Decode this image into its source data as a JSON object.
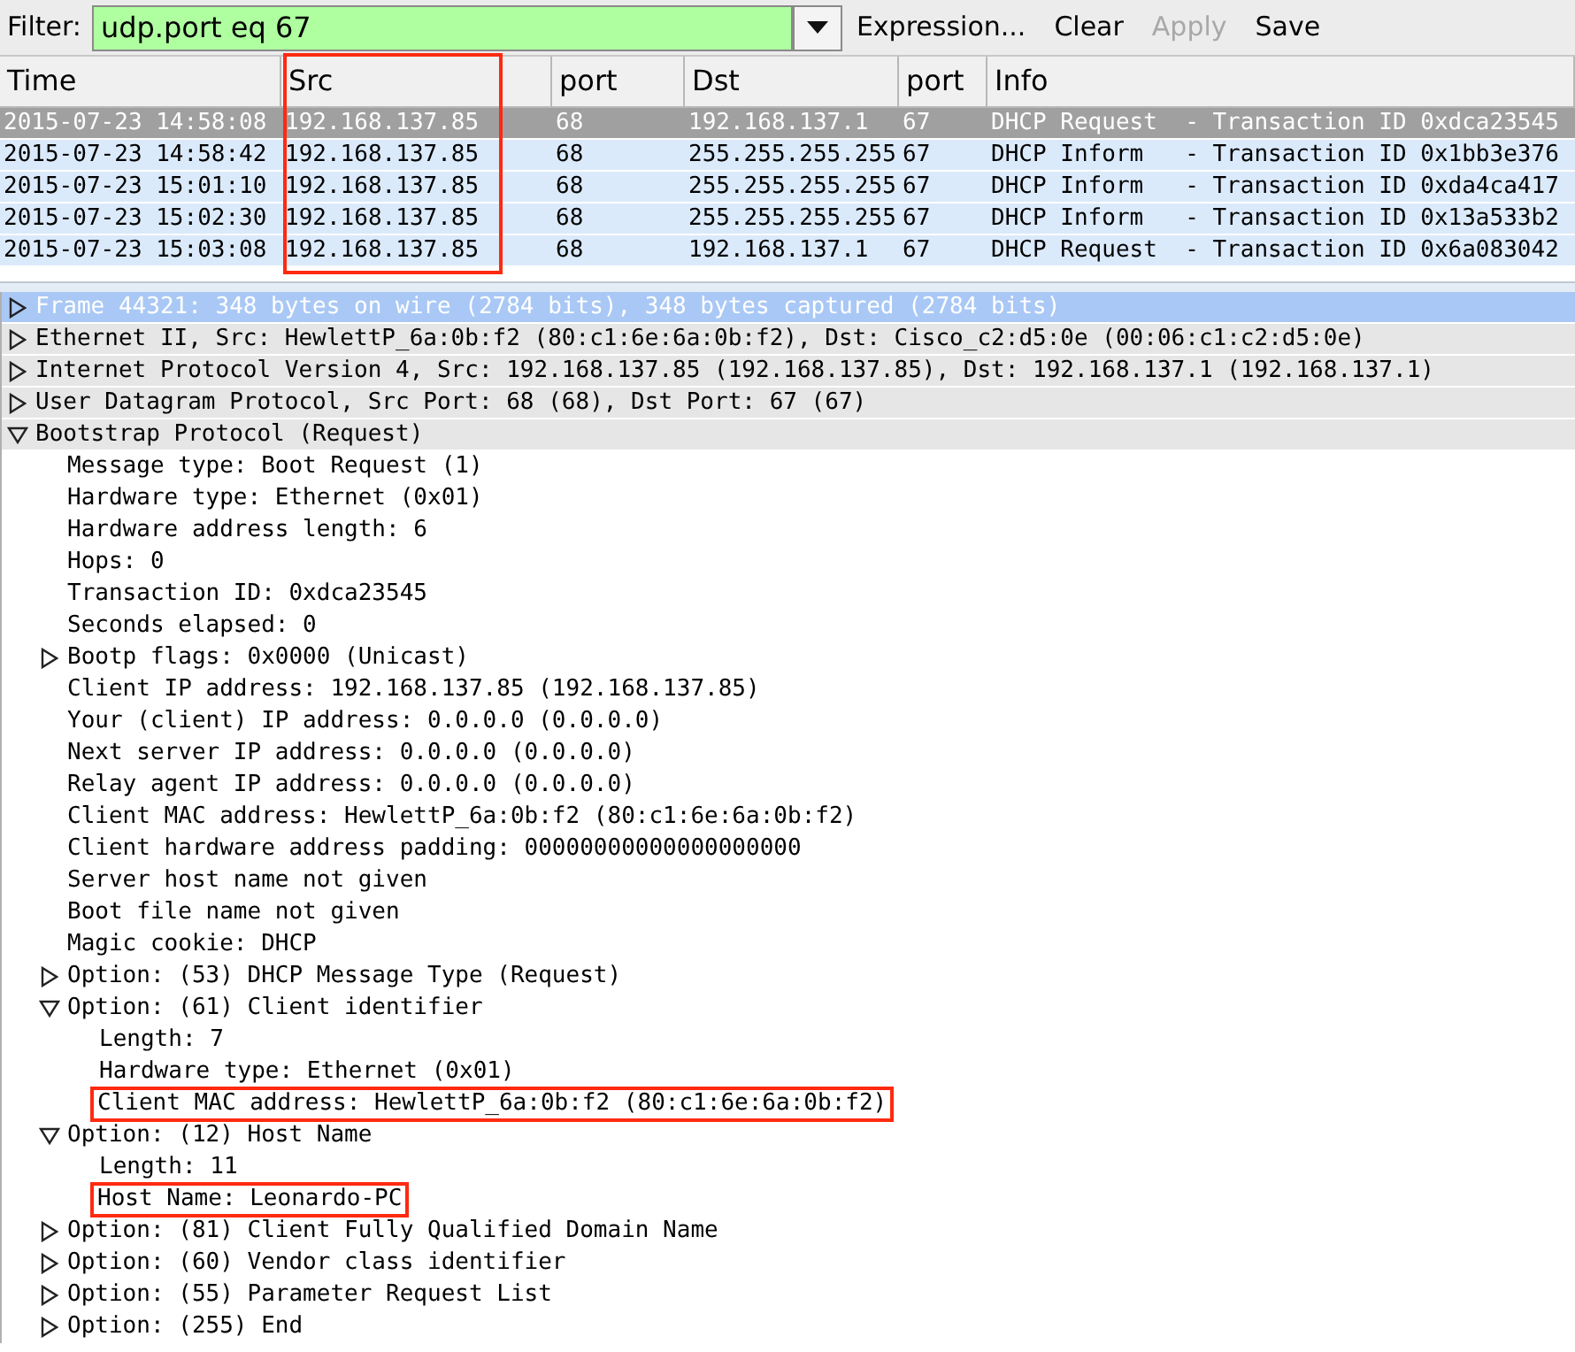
{
  "filter": {
    "label": "Filter:",
    "value": "udp.port eq 67",
    "actions": [
      {
        "label": "Expression...",
        "disabled": false
      },
      {
        "label": "Clear",
        "disabled": false
      },
      {
        "label": "Apply",
        "disabled": true
      },
      {
        "label": "Save",
        "disabled": false
      }
    ]
  },
  "packet_list": {
    "columns": [
      {
        "label": "Time",
        "highlighted": false
      },
      {
        "label": "Src",
        "highlighted": true
      },
      {
        "label": "port",
        "highlighted": false
      },
      {
        "label": "Dst",
        "highlighted": false
      },
      {
        "label": "port",
        "highlighted": false
      },
      {
        "label": "Info",
        "highlighted": false
      }
    ],
    "rows": [
      {
        "selected": true,
        "cells": [
          "2015-07-23 14:58:08",
          "192.168.137.85",
          "68",
          "192.168.137.1",
          "67",
          "DHCP Request  - Transaction ID 0xdca23545"
        ]
      },
      {
        "selected": false,
        "cells": [
          "2015-07-23 14:58:42",
          "192.168.137.85",
          "68",
          "255.255.255.255",
          "67",
          "DHCP Inform   - Transaction ID 0x1bb3e376"
        ]
      },
      {
        "selected": false,
        "cells": [
          "2015-07-23 15:01:10",
          "192.168.137.85",
          "68",
          "255.255.255.255",
          "67",
          "DHCP Inform   - Transaction ID 0xda4ca417"
        ]
      },
      {
        "selected": false,
        "cells": [
          "2015-07-23 15:02:30",
          "192.168.137.85",
          "68",
          "255.255.255.255",
          "67",
          "DHCP Inform   - Transaction ID 0x13a533b2"
        ]
      },
      {
        "selected": false,
        "cells": [
          "2015-07-23 15:03:08",
          "192.168.137.85",
          "68",
          "192.168.137.1",
          "67",
          "DHCP Request  - Transaction ID 0x6a083042"
        ]
      }
    ]
  },
  "details": [
    {
      "text": "Frame 44321: 348 bytes on wire (2784 bits), 348 bytes captured (2784 bits)",
      "expanded": false,
      "selected": true
    },
    {
      "text": "Ethernet II, Src: HewlettP_6a:0b:f2 (80:c1:6e:6a:0b:f2), Dst: Cisco_c2:d5:0e (00:06:c1:c2:d5:0e)",
      "expanded": false,
      "selected": false
    },
    {
      "text": "Internet Protocol Version 4, Src: 192.168.137.85 (192.168.137.85), Dst: 192.168.137.1 (192.168.137.1)",
      "expanded": false,
      "selected": false
    },
    {
      "text": "User Datagram Protocol, Src Port: 68 (68), Dst Port: 67 (67)",
      "expanded": false,
      "selected": false
    },
    {
      "text": "Bootstrap Protocol (Request)",
      "expanded": true,
      "selected": false,
      "children": [
        {
          "text": "Message type: Boot Request (1)"
        },
        {
          "text": "Hardware type: Ethernet (0x01)"
        },
        {
          "text": "Hardware address length: 6"
        },
        {
          "text": "Hops: 0"
        },
        {
          "text": "Transaction ID: 0xdca23545"
        },
        {
          "text": "Seconds elapsed: 0"
        },
        {
          "text": "Bootp flags: 0x0000 (Unicast)",
          "expanded": false
        },
        {
          "text": "Client IP address: 192.168.137.85 (192.168.137.85)"
        },
        {
          "text": "Your (client) IP address: 0.0.0.0 (0.0.0.0)"
        },
        {
          "text": "Next server IP address: 0.0.0.0 (0.0.0.0)"
        },
        {
          "text": "Relay agent IP address: 0.0.0.0 (0.0.0.0)"
        },
        {
          "text": "Client MAC address: HewlettP_6a:0b:f2 (80:c1:6e:6a:0b:f2)"
        },
        {
          "text": "Client hardware address padding: 00000000000000000000"
        },
        {
          "text": "Server host name not given"
        },
        {
          "text": "Boot file name not given"
        },
        {
          "text": "Magic cookie: DHCP"
        },
        {
          "text": "Option: (53) DHCP Message Type (Request)",
          "expanded": false
        },
        {
          "text": "Option: (61) Client identifier",
          "expanded": true,
          "children": [
            {
              "text": "Length: 7"
            },
            {
              "text": "Hardware type: Ethernet (0x01)"
            },
            {
              "text": "Client MAC address: HewlettP_6a:0b:f2 (80:c1:6e:6a:0b:f2)",
              "highlighted": true
            }
          ]
        },
        {
          "text": "Option: (12) Host Name",
          "expanded": true,
          "children": [
            {
              "text": "Length: 11"
            },
            {
              "text": "Host Name: Leonardo-PC",
              "highlighted": true
            }
          ]
        },
        {
          "text": "Option: (81) Client Fully Qualified Domain Name",
          "expanded": false
        },
        {
          "text": "Option: (60) Vendor class identifier",
          "expanded": false
        },
        {
          "text": "Option: (55) Parameter Request List",
          "expanded": false
        },
        {
          "text": "Option: (255) End",
          "expanded": false
        }
      ]
    }
  ]
}
